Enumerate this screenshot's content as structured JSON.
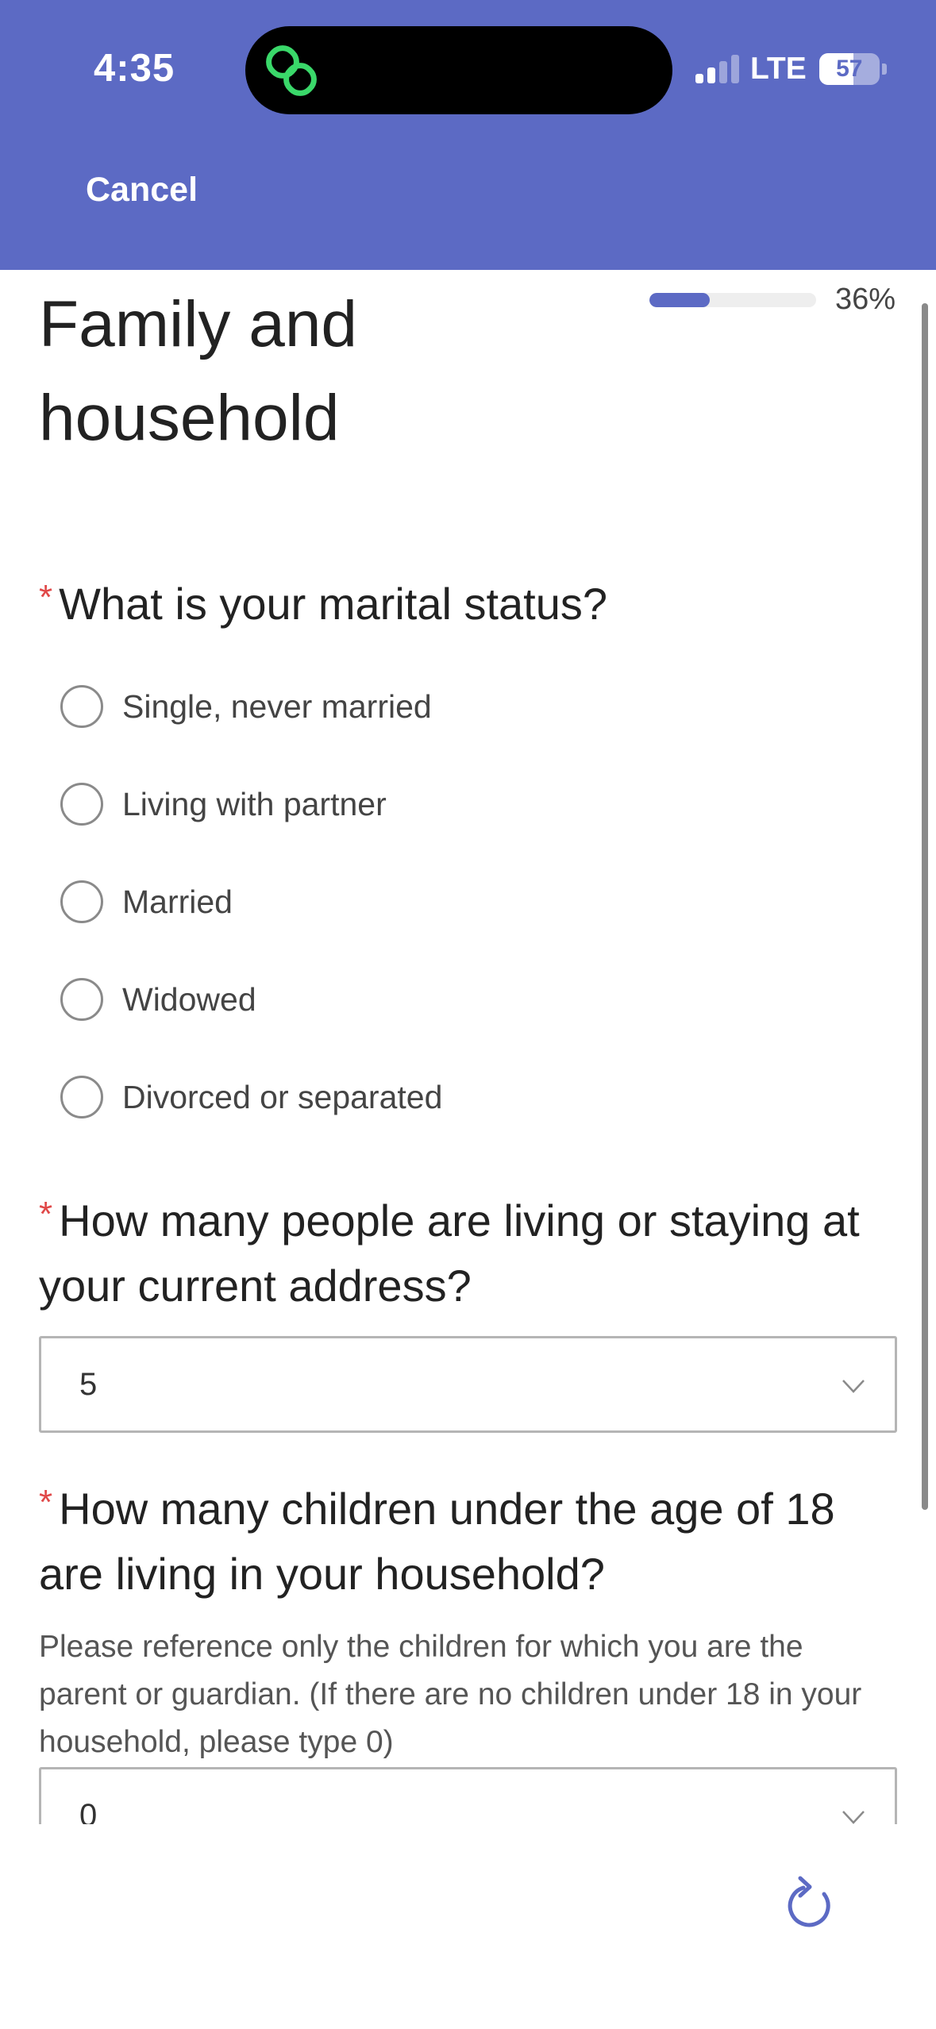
{
  "status_bar": {
    "time": "4:35",
    "network": "LTE",
    "battery": "57",
    "battery_level": 0.57,
    "signal_bars_active": 2,
    "signal_bars_total": 4
  },
  "header": {
    "cancel_label": "Cancel",
    "background_color": "#5c6ac4"
  },
  "progress": {
    "value": 0.36,
    "label": "36%",
    "accent_color": "#5c6ac4"
  },
  "page": {
    "title": "Family and household"
  },
  "questions": [
    {
      "required_marker": "*",
      "text": "What is your marital status?",
      "options": [
        "Single, never married",
        "Living with partner",
        "Married",
        "Widowed",
        "Divorced or separated"
      ]
    },
    {
      "required_marker": "*",
      "text": "How many people are living or staying at your current address?",
      "selected_value": "5"
    },
    {
      "required_marker": "*",
      "text": "How many children under the age of 18 are living in your household?",
      "helper": "Please reference only the children for which you are the parent or guardian. (If there are no children under 18 in your household, please type 0)",
      "selected_value": "0"
    }
  ],
  "icons": {
    "island_app": "linked-rings-icon",
    "refresh": "refresh-icon",
    "dropdown": "chevron-down-icon"
  }
}
